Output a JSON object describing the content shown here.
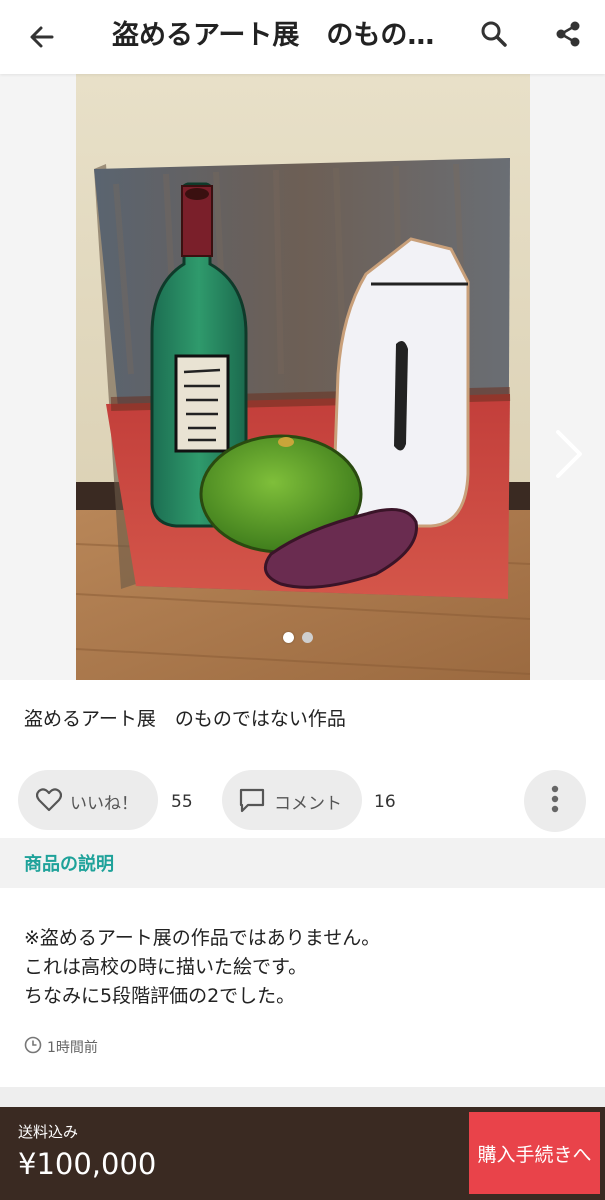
{
  "appbar": {
    "title": "盗めるアート展　のものではない作品",
    "back_icon": "arrow-left-icon",
    "search_icon": "search-icon",
    "share_icon": "share-icon"
  },
  "gallery": {
    "slide_count": 2,
    "active_index": 0,
    "image_description": "oil painting still life: green bottle, white pitcher, green melon, purple sweet potato"
  },
  "item": {
    "title": "盗めるアート展　のものではない作品"
  },
  "actions": {
    "like_label": "いいね！",
    "like_count": "55",
    "comment_label": "コメント",
    "comment_count": "16"
  },
  "description": {
    "heading": "商品の説明",
    "lines": [
      "※盗めるアート展の作品ではありません。",
      "これは高校の時に描いた絵です。",
      "ちなみに5段階評価の2でした。"
    ],
    "time": "1時間前"
  },
  "purchase": {
    "shipping": "送料込み",
    "price": "¥100,000",
    "buy_label": "購入手続きへ"
  },
  "colors": {
    "accent": "#1fa29a",
    "buy": "#e9434a",
    "bottom_bar": "#3a2a22"
  }
}
